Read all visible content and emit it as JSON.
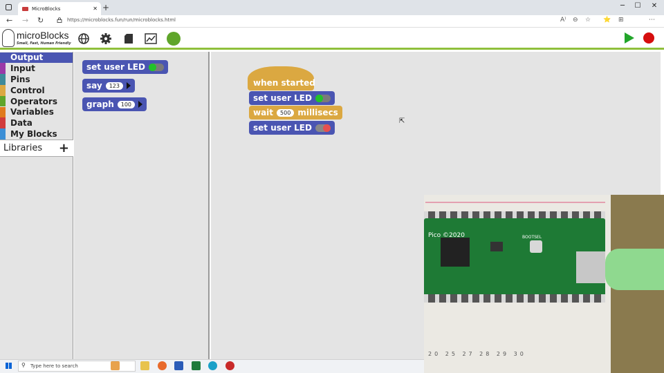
{
  "browser": {
    "tab_title": "MicroBlocks",
    "tab_close": "✕",
    "new_tab": "+",
    "url": "https://microblocks.fun/run/microblocks.html",
    "window_controls": [
      "─",
      "☐",
      "✕"
    ],
    "nav": [
      "←",
      "→",
      "↻"
    ],
    "right_icons": [
      "A⁾",
      "⊖",
      "☆",
      "⭐",
      "⊞",
      "⋯"
    ]
  },
  "app": {
    "logo_title": "microBlocks",
    "logo_subtitle": "Small, Fast, Human Friendly",
    "toolbar_icons": [
      "globe-icon",
      "gear-icon",
      "file-icon",
      "graph-icon",
      "usb-connect-icon"
    ],
    "colors": {
      "accent_green": "#8fbf3b",
      "output_blue": "#4a55b2",
      "control_gold": "#dba841",
      "stop_red": "#d60e0e",
      "go_green": "#22a52a"
    }
  },
  "categories": [
    {
      "label": "Output",
      "color": "#4a55b2",
      "selected": true
    },
    {
      "label": "Input",
      "color": "#9b39a8",
      "selected": false
    },
    {
      "label": "Pins",
      "color": "#3e8a9a",
      "selected": false
    },
    {
      "label": "Control",
      "color": "#dba841",
      "selected": false
    },
    {
      "label": "Operators",
      "color": "#5fa52a",
      "selected": false
    },
    {
      "label": "Variables",
      "color": "#e07b1e",
      "selected": false
    },
    {
      "label": "Data",
      "color": "#d13c3c",
      "selected": false
    },
    {
      "label": "My Blocks",
      "color": "#3c8fd6",
      "selected": false
    }
  ],
  "libraries": {
    "label": "Libraries",
    "add": "+"
  },
  "palette_blocks": [
    {
      "label": "set user LED",
      "toggle": "on"
    },
    {
      "label": "say",
      "value": "123",
      "arrow": true
    },
    {
      "label": "graph",
      "value": "100",
      "arrow": true
    }
  ],
  "script": {
    "hat": "when started",
    "blocks": [
      {
        "label": "set user LED",
        "toggle": "on"
      },
      {
        "label": "wait",
        "value": "500",
        "suffix": "millisecs"
      },
      {
        "label": "set user LED",
        "toggle": "off"
      }
    ]
  },
  "camera": {
    "board_label": "Pico ©2020",
    "chip_text": "BOOTSEL",
    "board_numbers": "20  25  27  28  29  30"
  },
  "taskbar": {
    "search_placeholder": "Type here to search"
  }
}
